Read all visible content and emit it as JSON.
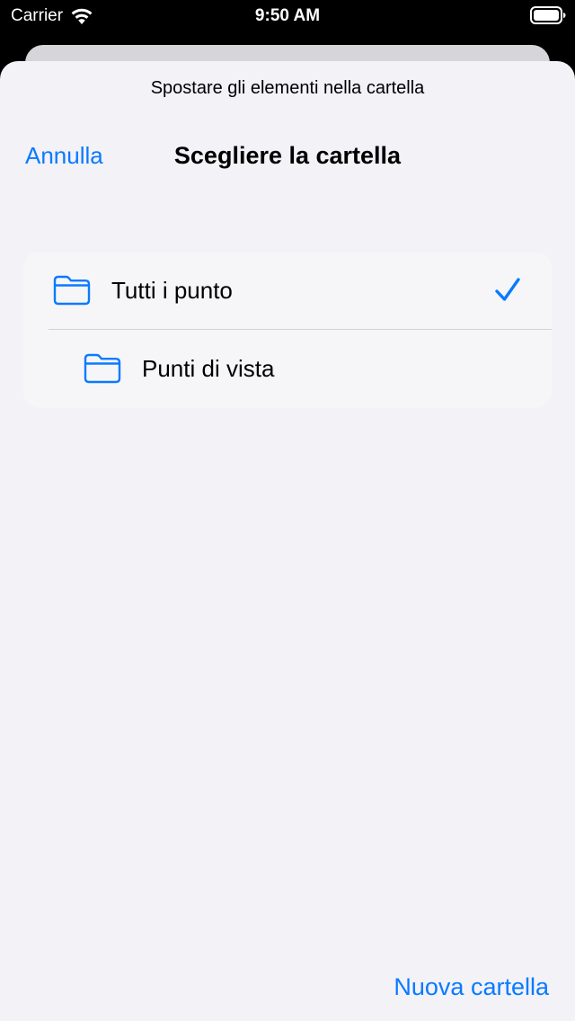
{
  "status_bar": {
    "carrier": "Carrier",
    "time": "9:50 AM",
    "icons": [
      "wifi-icon",
      "battery-icon"
    ]
  },
  "sheet": {
    "prompt": "Spostare gli elementi nella cartella",
    "cancel_label": "Annulla",
    "title": "Scegliere la cartella",
    "new_folder_label": "Nuova cartella"
  },
  "folders": [
    {
      "label": "Tutti i punto",
      "icon": "folder-icon",
      "selected": true,
      "level": 0
    },
    {
      "label": "Punti di vista",
      "icon": "folder-icon",
      "selected": false,
      "level": 1
    }
  ],
  "colors": {
    "accent": "#0a7aff",
    "sheet_background": "#f2f2f7",
    "card_background": "#f6f6f8",
    "status_bar_background": "#000000"
  }
}
